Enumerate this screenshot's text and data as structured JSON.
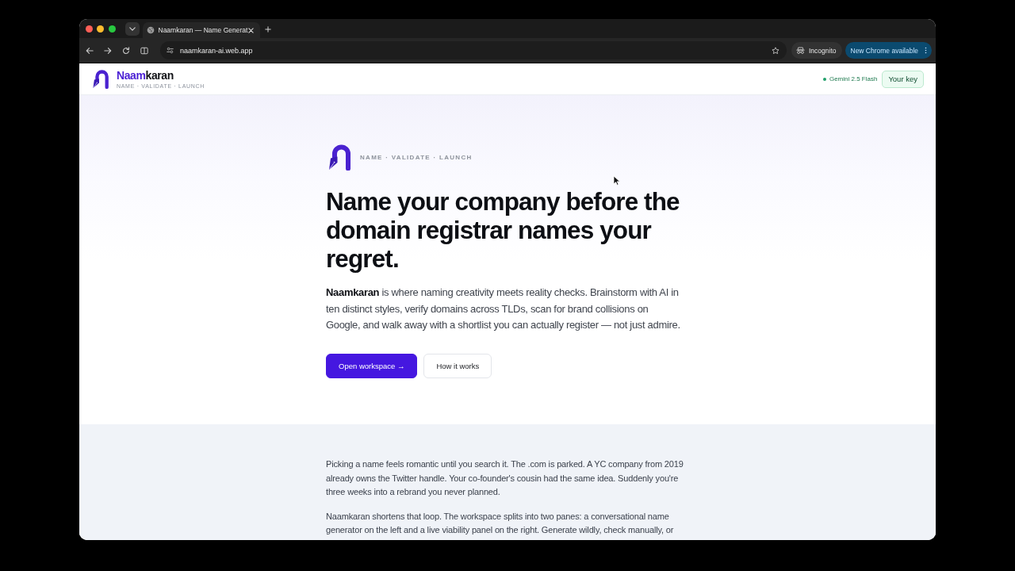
{
  "browser": {
    "tabs": [
      {
        "title": "Naamkaran — Name Generat",
        "selected": true
      }
    ],
    "url": "naamkaran-ai.web.app",
    "incognito_label": "Incognito",
    "update_button": "New Chrome available"
  },
  "header": {
    "brand": {
      "accent": "Naam",
      "rest": "karan"
    },
    "tagline": "NAME · VALIDATE · LAUNCH",
    "model_label": "Gemini 2.5 Flash",
    "key_button": "Your key"
  },
  "hero": {
    "tagline": "NAME · VALIDATE · LAUNCH",
    "heading": "Name your company before the domain registrar names your regret.",
    "intro": "**Naamkaran** is where naming creativity meets reality checks. Brainstorm with AI in ten distinct styles, verify domains across TLDs, scan for brand collisions on Google, and walk away with a shortlist you can actually register — not just admire.",
    "buttons": [
      {
        "label": "Open workspace →",
        "kind": "primary"
      },
      {
        "label": "How it works",
        "kind": "secondary"
      }
    ]
  },
  "story": {
    "paragraphs": [
      "Picking a name feels romantic until you search it. The .com is parked. A YC company from 2019 already owns the Twitter handle. Your co-founder's cousin had the same idea. Suddenly you're three weeks into a rebrand you never planned.",
      "Naamkaran shortens that loop. The workspace splits into two panes: a conversational name generator on the left and a live viability panel on the right. Generate wildly, check manually, or"
    ]
  }
}
